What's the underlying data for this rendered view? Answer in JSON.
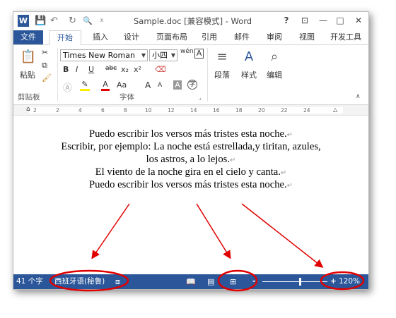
{
  "window": {
    "title": "Sample.doc [兼容模式] - Word",
    "logo": "W",
    "help": "?",
    "minimize": "—",
    "maximize": "□",
    "close": "✕",
    "ribbon_display": "⊡"
  },
  "qat": {
    "save": "💾",
    "undo": "↶",
    "redo": "↻",
    "preview": "🔍",
    "customize": "⩡"
  },
  "tabs": [
    "文件",
    "开始",
    "插入",
    "设计",
    "页面布局",
    "引用",
    "邮件",
    "审阅",
    "视图",
    "开发工具"
  ],
  "ribbon": {
    "clipboard": {
      "paste_label": "粘贴",
      "group_label": "剪贴板"
    },
    "font": {
      "font_name": "Times New Roman",
      "font_size": "小四",
      "bold": "B",
      "italic": "I",
      "underline": "U",
      "strikethrough": "abc",
      "subscript": "x₂",
      "superscript": "x²",
      "grow": "A",
      "shrink": "A",
      "change_case": "Aa",
      "group_label": "字体"
    },
    "paragraph": {
      "label": "段落"
    },
    "styles": {
      "label": "样式"
    },
    "editing": {
      "label": "编辑"
    }
  },
  "ruler": {
    "ticks": [
      "2",
      "2",
      "4",
      "6",
      "8",
      "10",
      "12",
      "14",
      "16",
      "18",
      "20",
      "22",
      "24"
    ]
  },
  "document": {
    "lines": [
      "Puedo escribir los versos más tristes esta noche.",
      "Escribir, por ejemplo: La noche está estrellada,y tiritan, azules,",
      "los astros, a lo lejos.",
      "El viento de la noche gira en el cielo y canta.",
      "Puedo escribir los versos más tristes esta noche."
    ],
    "para_mark": "↵"
  },
  "status": {
    "word_count": "41 个字",
    "language": "西班牙语(秘鲁)",
    "zoom_minus": "-",
    "zoom_plus": "+",
    "zoom": "120%"
  },
  "colors": {
    "accent": "#2b579a",
    "annotation": "#e00000"
  }
}
